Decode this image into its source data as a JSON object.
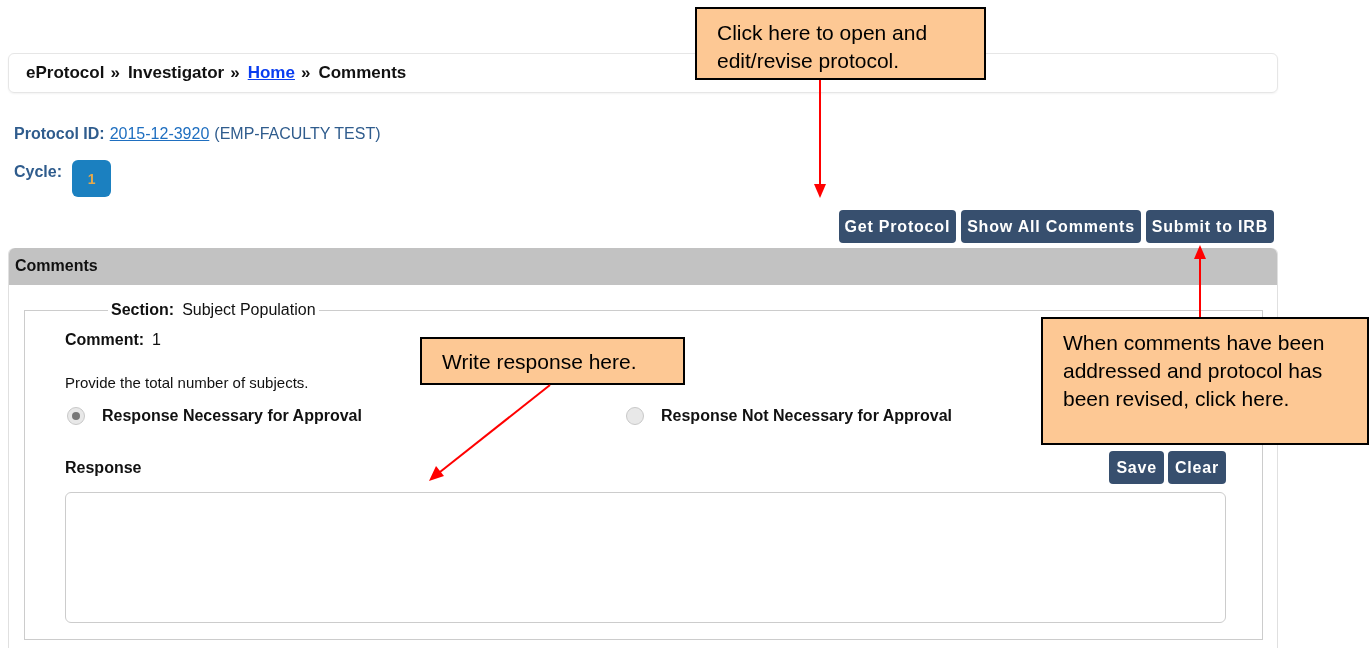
{
  "breadcrumb": [
    {
      "label": "eProtocol",
      "kind": "text"
    },
    {
      "label": "»",
      "kind": "separator"
    },
    {
      "label": "Investigator",
      "kind": "text"
    },
    {
      "label": "»",
      "kind": "separator"
    },
    {
      "label": "Home",
      "kind": "link"
    },
    {
      "label": "»",
      "kind": "separator"
    },
    {
      "label": "Comments",
      "kind": "text"
    }
  ],
  "protocol": {
    "label": "Protocol ID:",
    "id": "2015-12-3920",
    "name": "(EMP-FACULTY TEST)"
  },
  "cycle": {
    "label": "Cycle:",
    "badge": "1"
  },
  "actions": [
    "Get Protocol",
    "Show All Comments",
    "Submit to IRB"
  ],
  "panel": {
    "title": "Comments",
    "section": {
      "label": "Section:",
      "value": "Subject Population"
    },
    "comment": {
      "label": "Comment:",
      "value": "1"
    },
    "text": "Provide the total number of subjects.",
    "options": [
      {
        "label": "Response Necessary for Approval",
        "selected": true
      },
      {
        "label": "Response Not Necessary for Approval",
        "selected": false
      }
    ],
    "response_label": "Response",
    "response_buttons": [
      "Save",
      "Clear"
    ]
  },
  "callouts": [
    {
      "text": "Click here to open and edit/revise protocol."
    },
    {
      "text": "Write response here."
    },
    {
      "text": "When comments have been addressed and protocol has been revised, click here."
    }
  ]
}
